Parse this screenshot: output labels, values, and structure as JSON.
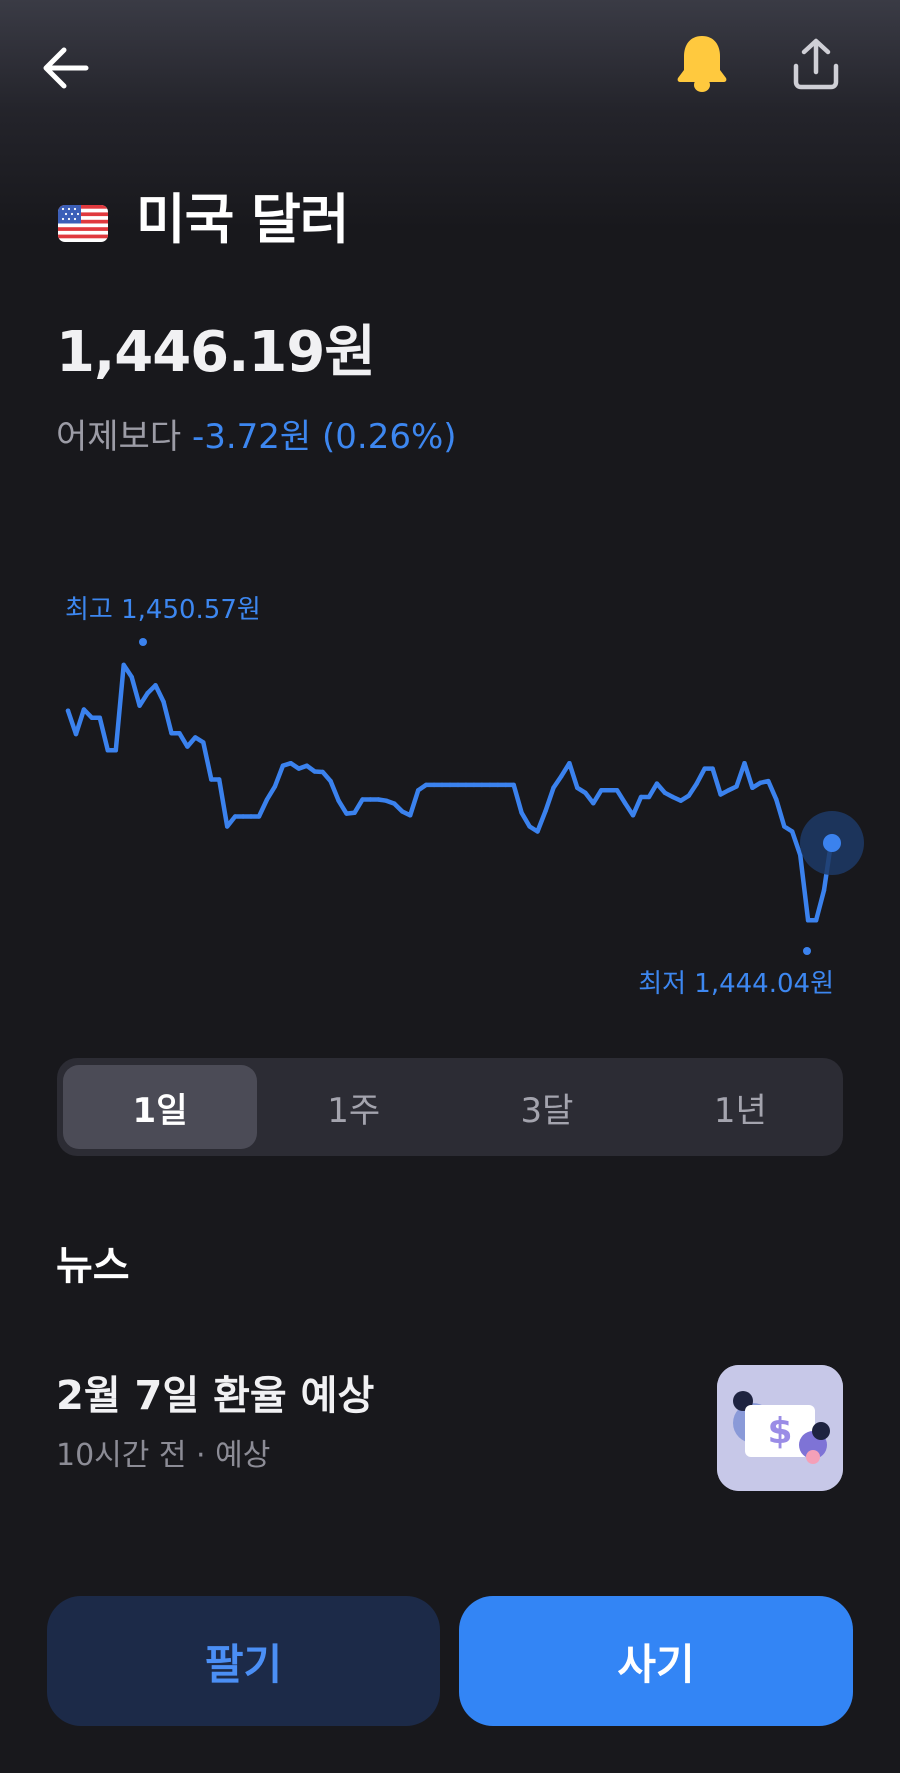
{
  "header": {
    "back_icon": "arrow-left-icon",
    "alert_icon": "bell-icon",
    "share_icon": "share-upload-icon",
    "bell_color": "#ffc93e"
  },
  "currency": {
    "flag_icon": "us-flag-icon",
    "name": "미국 달러",
    "price": "1,446.19원",
    "change_label": "어제보다",
    "change_value": "-3.72원 (0.26%)",
    "change_color": "#3d87f0"
  },
  "chart_data": {
    "type": "line",
    "high_label": "최고 1,450.57원",
    "low_label": "최저 1,444.04원",
    "series_color": "#3b82ee",
    "ylim": [
      1444.04,
      1450.57
    ],
    "values": [
      1449.4,
      1448.84,
      1449.43,
      1449.23,
      1449.23,
      1448.45,
      1448.45,
      1450.5,
      1450.21,
      1449.52,
      1449.82,
      1450.01,
      1449.62,
      1448.86,
      1448.86,
      1448.54,
      1448.76,
      1448.64,
      1447.75,
      1447.75,
      1446.62,
      1446.86,
      1446.86,
      1446.86,
      1446.86,
      1447.27,
      1447.58,
      1448.08,
      1448.14,
      1448.01,
      1448.08,
      1447.94,
      1447.93,
      1447.71,
      1447.24,
      1446.93,
      1446.95,
      1447.27,
      1447.27,
      1447.27,
      1447.24,
      1447.17,
      1446.98,
      1446.89,
      1447.49,
      1447.62,
      1447.62,
      1447.62,
      1447.62,
      1447.62,
      1447.62,
      1447.62,
      1447.62,
      1447.62,
      1447.62,
      1447.62,
      1447.62,
      1446.95,
      1446.62,
      1446.5,
      1446.99,
      1447.55,
      1447.83,
      1448.14,
      1447.55,
      1447.43,
      1447.18,
      1447.49,
      1447.49,
      1447.49,
      1447.18,
      1446.89,
      1447.33,
      1447.33,
      1447.65,
      1447.43,
      1447.33,
      1447.24,
      1447.36,
      1447.65,
      1448.01,
      1448.01,
      1447.39,
      1447.49,
      1447.58,
      1448.14,
      1447.55,
      1447.67,
      1447.71,
      1447.27,
      1446.62,
      1446.5,
      1445.94,
      1444.37,
      1444.37,
      1445.09,
      1446.39
    ],
    "periods": [
      "1일",
      "1주",
      "3달",
      "1년"
    ]
  },
  "range_tabs": {
    "selected": "1일",
    "items": [
      {
        "label": "1일",
        "active": true
      },
      {
        "label": "1주",
        "active": false
      },
      {
        "label": "3달",
        "active": false
      },
      {
        "label": "1년",
        "active": false
      }
    ]
  },
  "news": {
    "heading": "뉴스",
    "items": [
      {
        "title": "2월 7일 환율 예상",
        "meta": "10시간 전 · 예상",
        "thumb_icon": "dollar-bill-illustration-icon"
      }
    ]
  },
  "actions": {
    "sell_label": "팔기",
    "buy_label": "사기"
  }
}
